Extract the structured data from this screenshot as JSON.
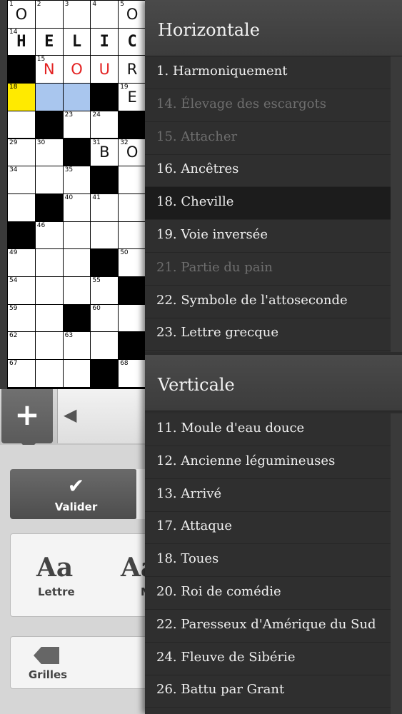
{
  "grid": {
    "numbers": {
      "0,0": "1",
      "0,1": "2",
      "0,2": "3",
      "0,3": "4",
      "0,4": "5",
      "1,0": "14",
      "2,1": "15",
      "3,0": "18",
      "3,4": "19",
      "4,2": "23",
      "4,3": "24",
      "5,0": "29",
      "5,1": "30",
      "5,3": "31",
      "5,4": "32",
      "6,0": "34",
      "6,2": "35",
      "7,2": "40",
      "7,3": "41",
      "8,1": "46",
      "9,0": "49",
      "9,4": "50",
      "10,0": "54",
      "10,3": "55",
      "11,0": "59",
      "11,3": "60",
      "12,0": "62",
      "12,2": "63",
      "13,0": "67",
      "13,4": "68"
    },
    "letters": {
      "0,0": {
        "ch": "O",
        "style": "plain"
      },
      "0,4": {
        "ch": "O",
        "style": "plain"
      },
      "1,0": {
        "ch": "H",
        "style": "bold"
      },
      "1,1": {
        "ch": "E",
        "style": "bold"
      },
      "1,2": {
        "ch": "L",
        "style": "bold"
      },
      "1,3": {
        "ch": "I",
        "style": "bold"
      },
      "1,4": {
        "ch": "C",
        "style": "bold"
      },
      "2,1": {
        "ch": "N",
        "style": "red"
      },
      "2,2": {
        "ch": "O",
        "style": "red"
      },
      "2,3": {
        "ch": "U",
        "style": "red"
      },
      "2,4": {
        "ch": "R",
        "style": "plain"
      },
      "3,4": {
        "ch": "E",
        "style": "plain"
      },
      "5,3": {
        "ch": "B",
        "style": "plain"
      },
      "5,4": {
        "ch": "O",
        "style": "plain"
      }
    },
    "black": [
      "2,0",
      "3,3",
      "4,1",
      "4,4",
      "5,2",
      "6,3",
      "7,1",
      "8,0",
      "9,3",
      "10,4",
      "11,2",
      "12,4",
      "13,3"
    ],
    "yellow": [
      "3,0"
    ],
    "blue": [
      "3,1",
      "3,2"
    ]
  },
  "toolbar": {
    "plus_glyph": "+",
    "back_glyph": "◀",
    "valider_check": "✔",
    "valider_label": "Valider",
    "aa_glyph": "Aa",
    "lettre_label": "Lettre",
    "aa2_glyph": "Aa",
    "aa2_label": "M",
    "grilles_label": "Grilles"
  },
  "clues": {
    "horizontal_title": "Horizontale",
    "horizontal": [
      {
        "text": "1. Harmoniquement",
        "state": "normal"
      },
      {
        "text": "14. Élevage des escargots",
        "state": "done"
      },
      {
        "text": "15. Attacher",
        "state": "done"
      },
      {
        "text": "16. Ancêtres",
        "state": "normal"
      },
      {
        "text": "18. Cheville",
        "state": "active"
      },
      {
        "text": "19. Voie inversée",
        "state": "normal"
      },
      {
        "text": "21. Partie du pain",
        "state": "done"
      },
      {
        "text": "22. Symbole de l'attoseconde",
        "state": "normal"
      },
      {
        "text": "23. Lettre grecque",
        "state": "normal"
      }
    ],
    "vertical_title": "Verticale",
    "vertical": [
      {
        "text": "11. Moule d'eau douce",
        "state": "normal"
      },
      {
        "text": "12. Ancienne légumineuses",
        "state": "normal"
      },
      {
        "text": "13. Arrivé",
        "state": "normal"
      },
      {
        "text": "17. Attaque",
        "state": "normal"
      },
      {
        "text": "18. Toues",
        "state": "normal"
      },
      {
        "text": "20. Roi de comédie",
        "state": "normal"
      },
      {
        "text": "22. Paresseux d'Amérique du Sud",
        "state": "normal"
      },
      {
        "text": "24. Fleuve de Sibérie",
        "state": "normal"
      },
      {
        "text": "26. Battu par Grant",
        "state": "normal"
      }
    ]
  }
}
